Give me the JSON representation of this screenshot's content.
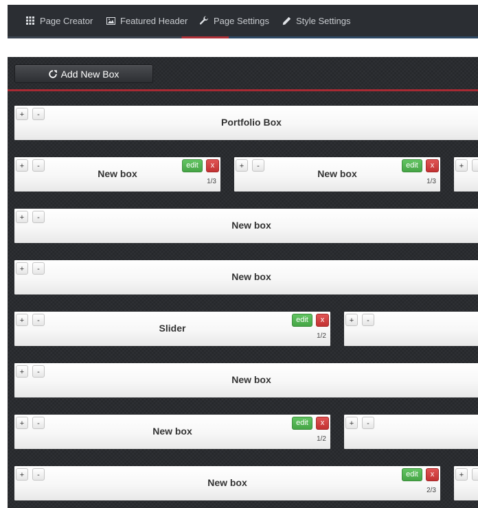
{
  "tabs": [
    {
      "label": "Page Creator",
      "icon": "grid-icon"
    },
    {
      "label": "Featured Header",
      "icon": "image-icon"
    },
    {
      "label": "Page Settings",
      "icon": "wrench-icon"
    },
    {
      "label": "Style Settings",
      "icon": "pencil-icon"
    }
  ],
  "toolbar": {
    "add_label": "Add New Box"
  },
  "controls": {
    "plus": "+",
    "minus": "-",
    "edit": "edit",
    "delete": "x"
  },
  "rows": [
    {
      "boxes": [
        {
          "title": "Portfolio Box",
          "size": null
        }
      ]
    },
    {
      "boxes": [
        {
          "title": "New box",
          "size": "1/3"
        },
        {
          "title": "New box",
          "size": "1/3"
        },
        {
          "title": "",
          "size": null
        }
      ]
    },
    {
      "boxes": [
        {
          "title": "New box",
          "size": null
        }
      ]
    },
    {
      "boxes": [
        {
          "title": "New box",
          "size": null
        }
      ]
    },
    {
      "boxes": [
        {
          "title": "Slider",
          "size": "1/2"
        },
        {
          "title": "",
          "size": null
        }
      ]
    },
    {
      "boxes": [
        {
          "title": "New box",
          "size": null
        }
      ]
    },
    {
      "boxes": [
        {
          "title": "New box",
          "size": "1/2"
        },
        {
          "title": "",
          "size": null
        }
      ]
    },
    {
      "boxes": [
        {
          "title": "New box",
          "size": "2/3"
        },
        {
          "title": "",
          "size": null
        }
      ]
    }
  ],
  "colors": {
    "accent_red": "#a82a33",
    "edit_green": "#46a546",
    "delete_red": "#c23232",
    "panel_bg": "#2a2c30"
  }
}
